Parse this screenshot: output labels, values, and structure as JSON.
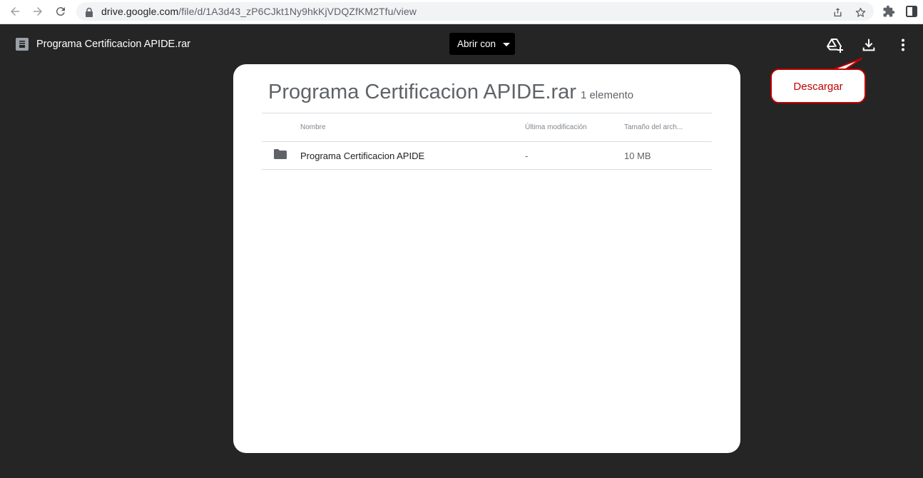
{
  "browser": {
    "url_host": "drive.google.com",
    "url_path": "/file/d/1A3d43_zP6CJkt1Ny9hkKjVDQZfKM2Tfu/view"
  },
  "viewer": {
    "file_title": "Programa Certificacion APIDE.rar",
    "open_with_label": "Abrir con"
  },
  "card": {
    "title": "Programa Certificacion APIDE.rar",
    "item_count": "1 elemento",
    "columns": [
      "Nombre",
      "Última modificación",
      "Tamaño del arch..."
    ],
    "rows": [
      {
        "name": "Programa Certificacion APIDE",
        "modified": "-",
        "size": "10 MB"
      }
    ]
  },
  "callout": {
    "label": "Descargar"
  },
  "colors": {
    "viewer_background": "#252525",
    "callout_accent": "#c00000",
    "folder_icon": "#5f6368"
  }
}
